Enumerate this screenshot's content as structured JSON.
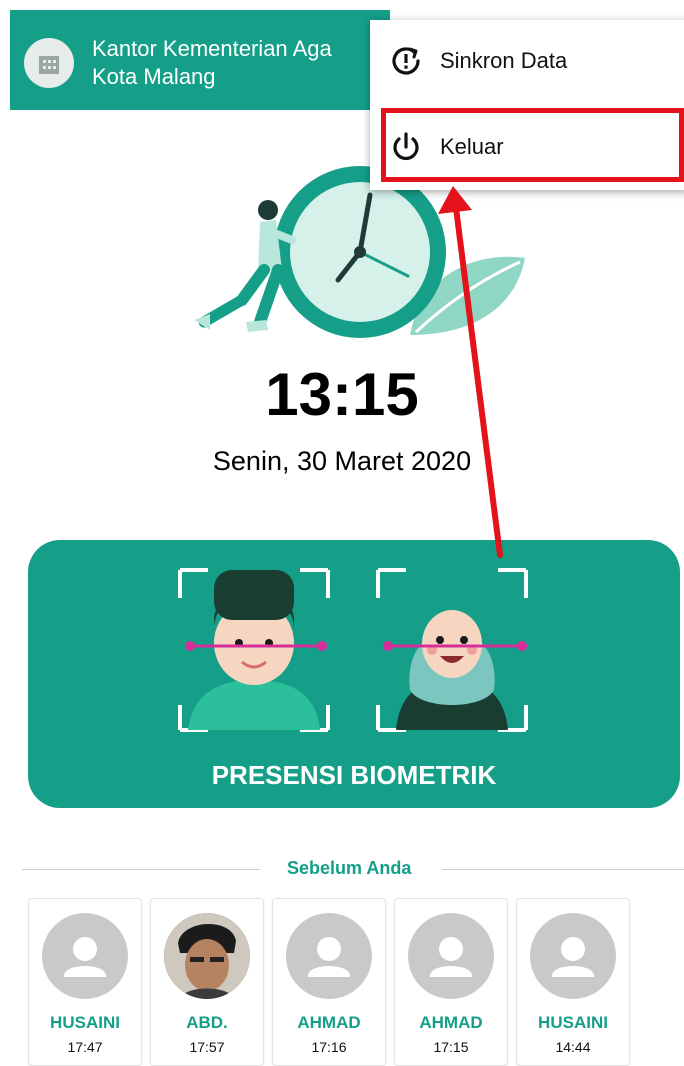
{
  "appbar": {
    "title_line1": "Kantor Kementerian Aga",
    "title_line2": "Kota Malang",
    "icon": "building-icon"
  },
  "menu": {
    "items": [
      {
        "label": "Sinkron Data",
        "icon": "sync-alert-icon"
      },
      {
        "label": "Keluar",
        "icon": "power-icon"
      }
    ]
  },
  "clock": {
    "time": "13:15",
    "date": "Senin, 30 Maret 2020"
  },
  "biometric": {
    "label": "PRESENSI BIOMETRIK"
  },
  "section": {
    "label": "Sebelum Anda"
  },
  "recent": [
    {
      "name": "HUSAINI",
      "time": "17:47",
      "photo": "default-avatar"
    },
    {
      "name": "ABD.",
      "time": "17:57",
      "photo": "user-photo"
    },
    {
      "name": "AHMAD",
      "time": "17:16",
      "photo": "default-avatar"
    },
    {
      "name": "AHMAD",
      "time": "17:15",
      "photo": "default-avatar"
    },
    {
      "name": "HUSAINI",
      "time": "14:44",
      "photo": "default-avatar"
    }
  ],
  "colors": {
    "primary": "#159f88",
    "highlight": "#e3121b",
    "avatar_bg": "#c9c9c9"
  }
}
